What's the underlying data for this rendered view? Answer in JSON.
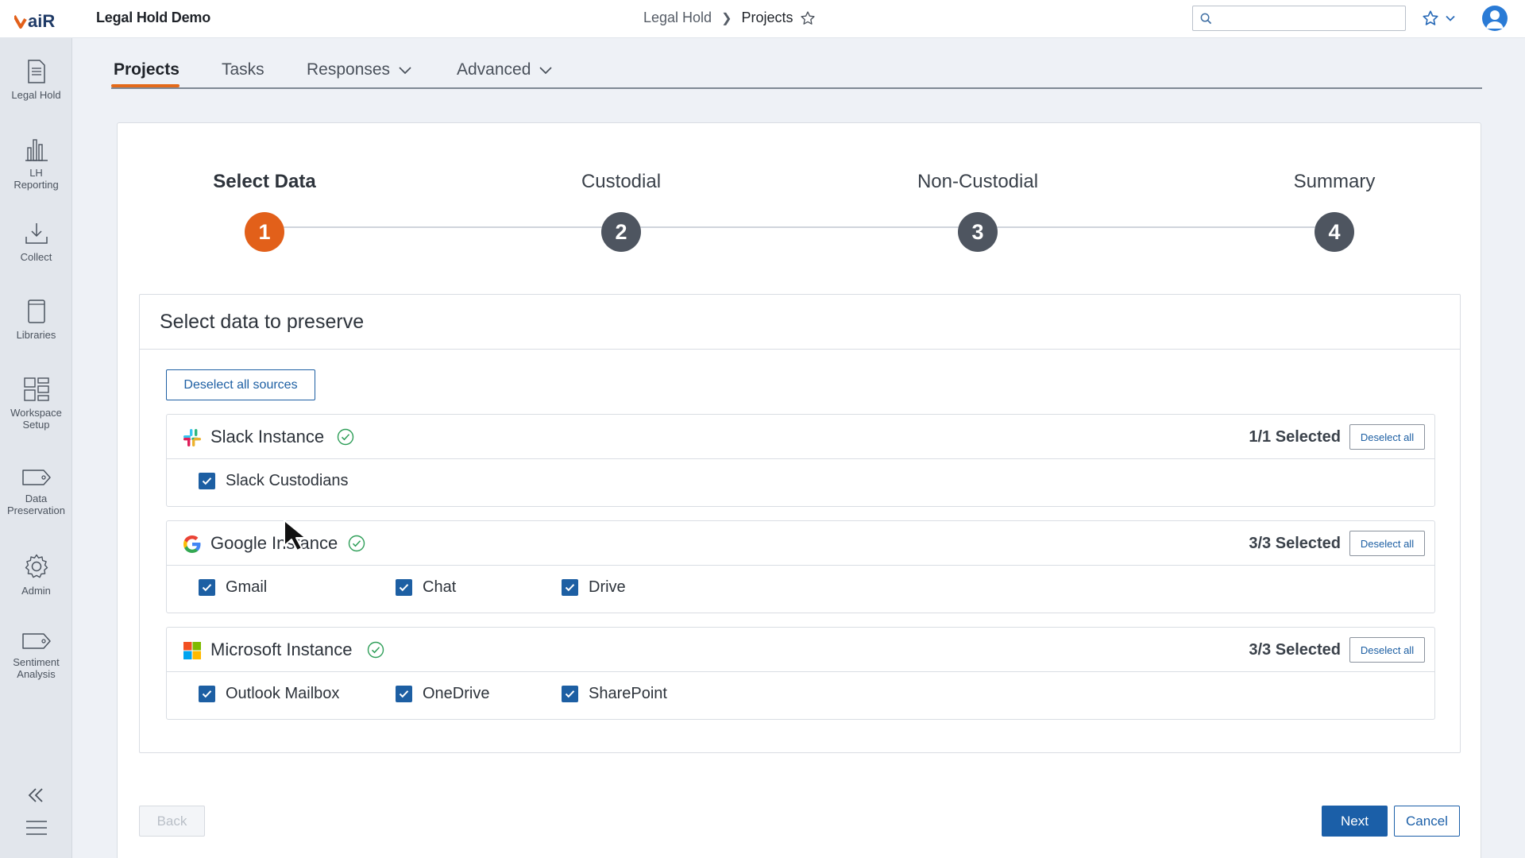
{
  "app": {
    "title": "Legal Hold Demo",
    "logo_icon": "air-logo-icon"
  },
  "breadcrumb": {
    "root": "Legal Hold",
    "current": "Projects"
  },
  "search": {
    "placeholder": "",
    "value": ""
  },
  "sidebar": {
    "items": [
      {
        "label": "Legal Hold",
        "icon": "document-icon"
      },
      {
        "label": "LH Reporting",
        "icon": "bar-chart-icon"
      },
      {
        "label": "Collect",
        "icon": "download-tray-icon"
      },
      {
        "label": "Libraries",
        "icon": "book-icon"
      },
      {
        "label": "Workspace Setup",
        "icon": "grid-icon"
      },
      {
        "label": "Data Preservation",
        "icon": "tag-icon"
      },
      {
        "label": "Admin",
        "icon": "gear-icon"
      },
      {
        "label": "Sentiment Analysis",
        "icon": "tag-icon"
      }
    ]
  },
  "tabs": [
    {
      "label": "Projects",
      "active": true
    },
    {
      "label": "Tasks",
      "active": false
    },
    {
      "label": "Responses",
      "active": false,
      "dropdown": true
    },
    {
      "label": "Advanced",
      "active": false,
      "dropdown": true
    }
  ],
  "stepper": {
    "current_step": 1,
    "steps": [
      {
        "number": "1",
        "label": "Select Data"
      },
      {
        "number": "2",
        "label": "Custodial"
      },
      {
        "number": "3",
        "label": "Non-Custodial"
      },
      {
        "number": "4",
        "label": "Summary"
      }
    ]
  },
  "panel": {
    "title": "Select data to preserve",
    "deselect_all_sources": "Deselect all sources",
    "sources": [
      {
        "name": "Slack Instance",
        "icon": "slack-logo-icon",
        "count": "1/1 Selected",
        "deselect_label": "Deselect all",
        "options": [
          {
            "label": "Slack Custodians",
            "checked": true
          }
        ]
      },
      {
        "name": "Google Instance",
        "icon": "google-logo-icon",
        "count": "3/3 Selected",
        "deselect_label": "Deselect all",
        "options": [
          {
            "label": "Gmail",
            "checked": true
          },
          {
            "label": "Chat",
            "checked": true
          },
          {
            "label": "Drive",
            "checked": true
          }
        ]
      },
      {
        "name": "Microsoft Instance",
        "icon": "microsoft-logo-icon",
        "count": "3/3 Selected",
        "deselect_label": "Deselect all",
        "options": [
          {
            "label": "Outlook Mailbox",
            "checked": true
          },
          {
            "label": "OneDrive",
            "checked": true
          },
          {
            "label": "SharePoint",
            "checked": true
          }
        ]
      }
    ]
  },
  "footer": {
    "back": "Back",
    "next": "Next",
    "cancel": "Cancel"
  },
  "colors": {
    "accent": "#e2601a",
    "primary": "#1b5fa8",
    "step_inactive": "#4e5560",
    "status_ok": "#2e9e58"
  }
}
